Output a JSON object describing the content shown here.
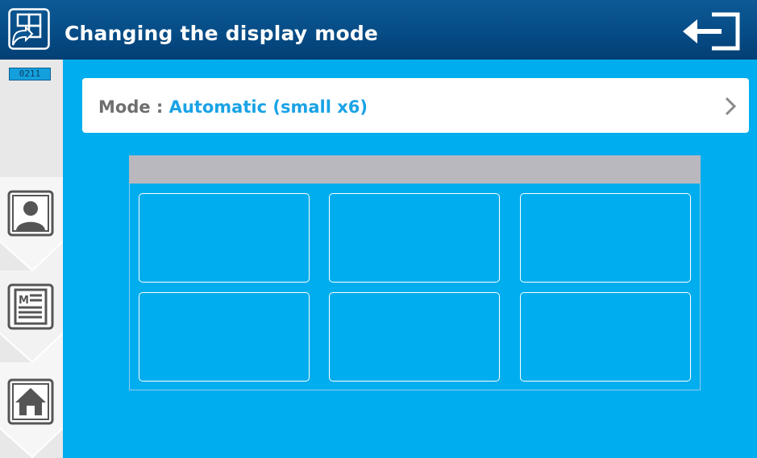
{
  "header": {
    "title": "Changing the display mode",
    "app_icon": "display-layout-icon",
    "exit_icon": "exit-icon"
  },
  "sidebar": {
    "device_id": "0211",
    "buttons": [
      {
        "icon": "user-icon"
      },
      {
        "icon": "memo-icon"
      },
      {
        "icon": "home-icon"
      }
    ]
  },
  "mode": {
    "label": "Mode : ",
    "value": "Automatic (small x6)"
  },
  "preview": {
    "tiles": 6
  },
  "colors": {
    "background": "#00adee",
    "header": "#064c86",
    "accent": "#1aa3e6",
    "preview_bar": "#bab8bf"
  }
}
